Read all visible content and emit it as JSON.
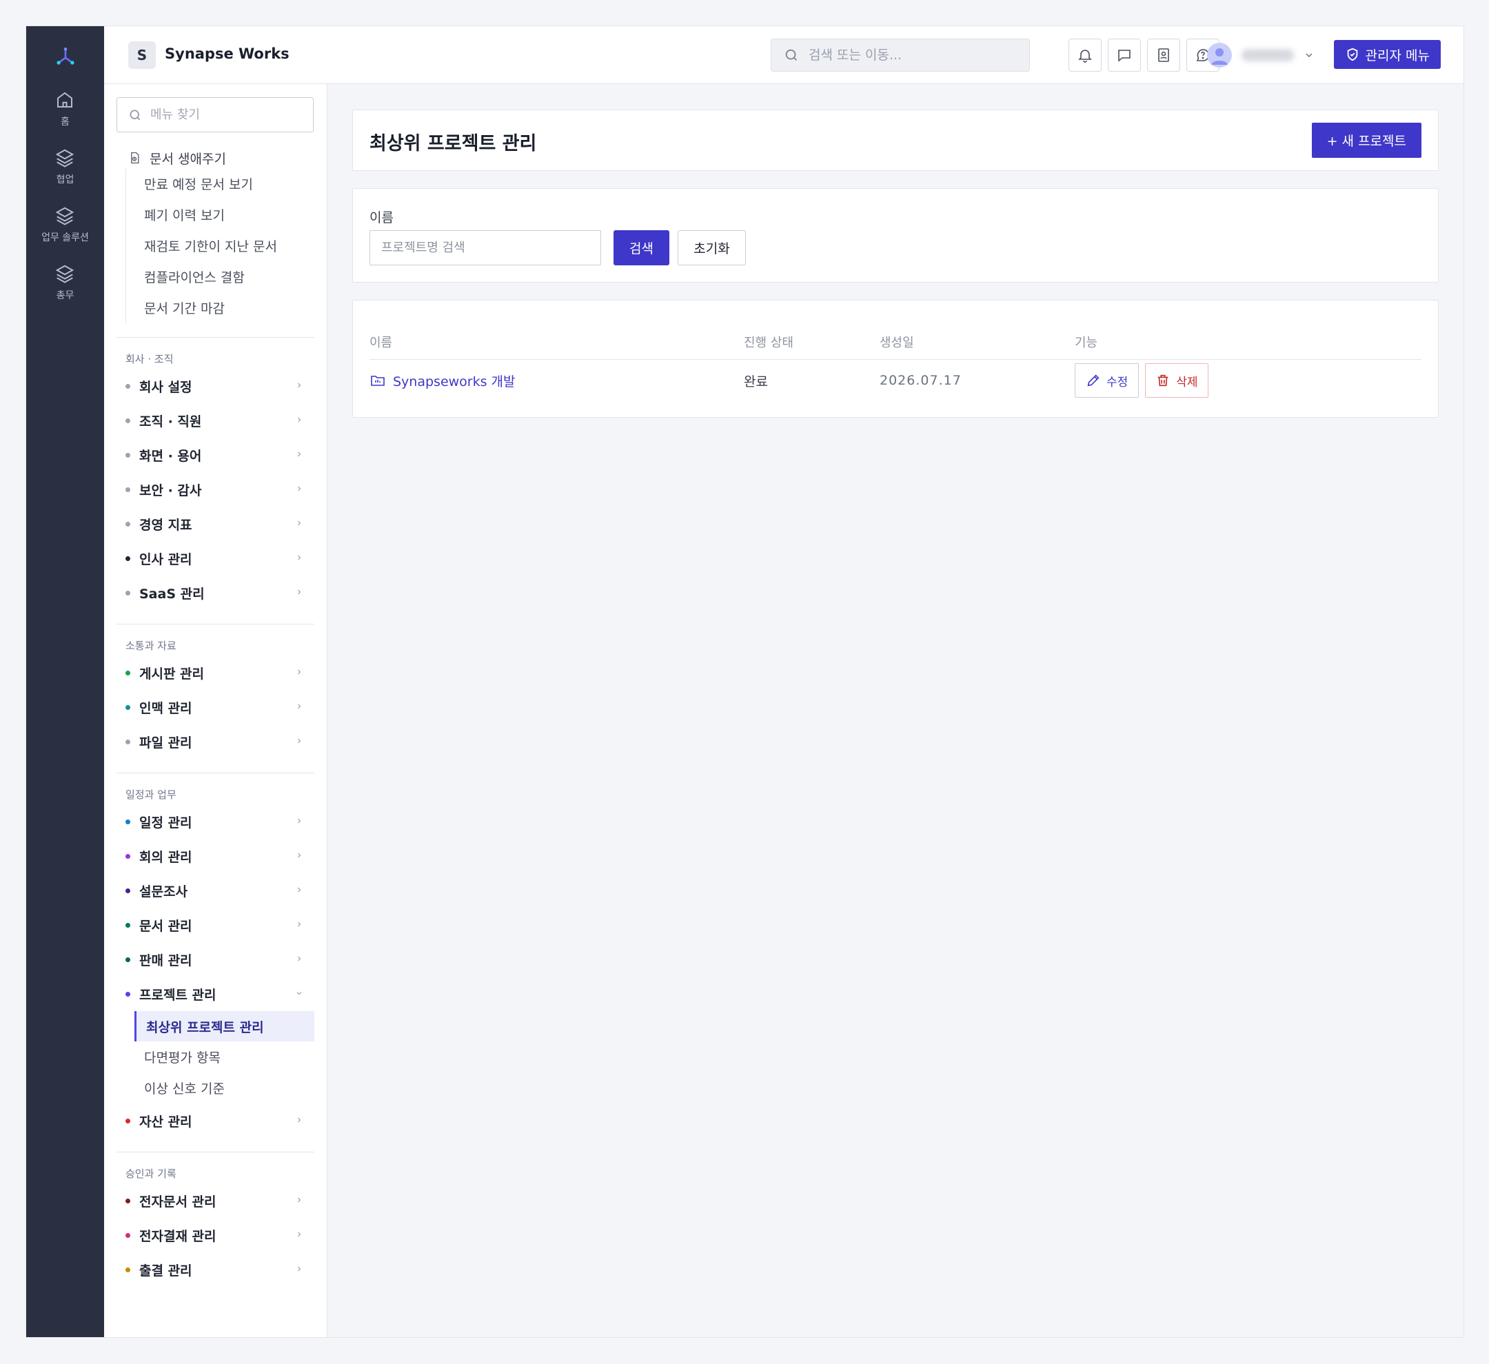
{
  "app": {
    "org_initial": "S",
    "org_name": "Synapse Works"
  },
  "rail": [
    {
      "label": "홈",
      "icon": "home-icon"
    },
    {
      "label": "협업",
      "icon": "layers-icon"
    },
    {
      "label": "업무 솔루션",
      "icon": "layers-icon"
    },
    {
      "label": "총무",
      "icon": "layers-icon"
    }
  ],
  "topbar": {
    "search_placeholder": "검색 또는 이동...",
    "admin_label": "관리자 메뉴"
  },
  "sidebar": {
    "search_placeholder": "메뉴 찾기",
    "lifecycle": {
      "title": "문서 생애주기",
      "items": [
        "만료 예정 문서 보기",
        "폐기 이력 보기",
        "재검토 기한이 지난 문서",
        "컴플라이언스 결함",
        "문서 기간 마감"
      ]
    },
    "sections": [
      {
        "title": "회사 · 조직",
        "items": [
          {
            "label": "회사 설정",
            "color": "#9ca3af"
          },
          {
            "label": "조직 · 직원",
            "color": "#9ca3af"
          },
          {
            "label": "화면 · 용어",
            "color": "#9ca3af"
          },
          {
            "label": "보안 · 감사",
            "color": "#9ca3af"
          },
          {
            "label": "경영 지표",
            "color": "#9ca3af"
          },
          {
            "label": "인사 관리",
            "color": "#1f2937"
          },
          {
            "label": "SaaS 관리",
            "color": "#9ca3af"
          }
        ]
      },
      {
        "title": "소통과 자료",
        "items": [
          {
            "label": "게시판 관리",
            "color": "#16a34a"
          },
          {
            "label": "인맥 관리",
            "color": "#0d9488"
          },
          {
            "label": "파일 관리",
            "color": "#9ca3af"
          }
        ]
      },
      {
        "title": "일정과 업무",
        "items": [
          {
            "label": "일정 관리",
            "color": "#0284c7"
          },
          {
            "label": "회의 관리",
            "color": "#9333ea"
          },
          {
            "label": "설문조사",
            "color": "#4c1d95"
          },
          {
            "label": "문서 관리",
            "color": "#047857"
          },
          {
            "label": "판매 관리",
            "color": "#115e59"
          },
          {
            "label": "프로젝트 관리",
            "color": "#4f46e5"
          },
          {
            "label": "자산 관리",
            "color": "#dc2626"
          }
        ]
      },
      {
        "title": "승인과 기록",
        "items": [
          {
            "label": "전자문서 관리",
            "color": "#7f1d1d"
          },
          {
            "label": "전자결재 관리",
            "color": "#db2777"
          },
          {
            "label": "출결 관리",
            "color": "#ca8a04"
          }
        ]
      }
    ],
    "project_sub": [
      "최상위 프로젝트 관리",
      "다면평가 항목",
      "이상 신호 기준"
    ]
  },
  "main": {
    "title": "최상위 프로젝트 관리",
    "new_button": "+ 새 프로젝트",
    "filter": {
      "label": "이름",
      "placeholder": "프로젝트명 검색",
      "search": "검색",
      "reset": "초기화"
    },
    "table": {
      "headers": [
        "이름",
        "진행 상태",
        "생성일",
        "기능"
      ],
      "rows": [
        {
          "name": "Synapseworks 개발",
          "status": "완료",
          "created": "2026.07.17",
          "edit": "수정",
          "delete": "삭제"
        }
      ]
    }
  }
}
